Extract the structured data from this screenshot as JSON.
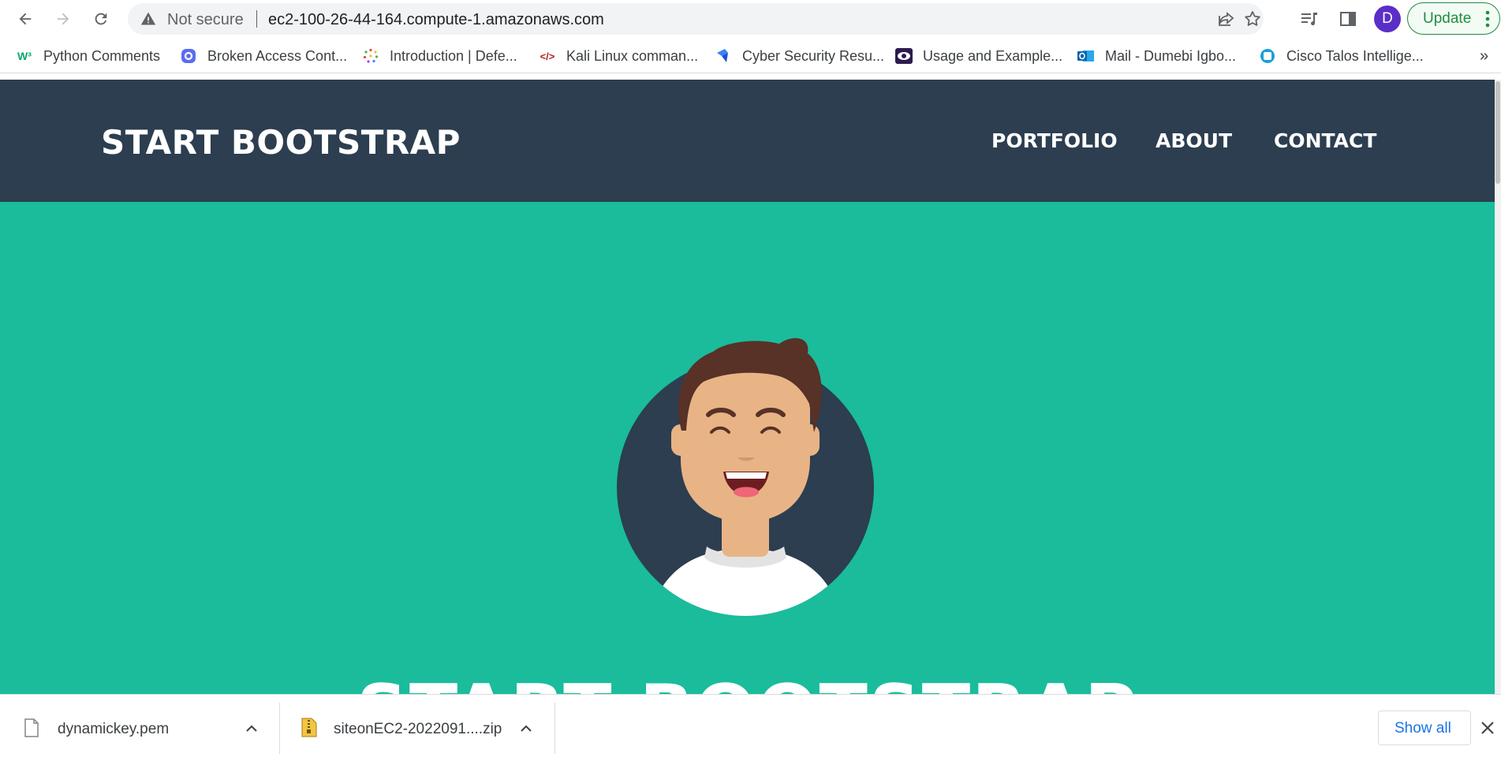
{
  "browser": {
    "security_label": "Not secure",
    "url": "ec2-100-26-44-164.compute-1.amazonaws.com",
    "profile_initial": "D",
    "update_label": "Update"
  },
  "bookmarks": [
    {
      "label": "Python Comments",
      "icon": "w3schools-icon"
    },
    {
      "label": "Broken Access Cont...",
      "icon": "bookmark-a-icon"
    },
    {
      "label": "Introduction | Defe...",
      "icon": "dots-circle-icon"
    },
    {
      "label": "Kali Linux comman...",
      "icon": "code-icon"
    },
    {
      "label": "Cyber Security Resu...",
      "icon": "blue-shape-icon"
    },
    {
      "label": "Usage and Example...",
      "icon": "eye-icon"
    },
    {
      "label": "Mail - Dumebi Igbo...",
      "icon": "outlook-icon"
    },
    {
      "label": "Cisco Talos Intellige...",
      "icon": "talos-icon"
    }
  ],
  "site": {
    "brand": "START BOOTSTRAP",
    "nav": [
      "PORTFOLIO",
      "ABOUT",
      "CONTACT"
    ],
    "masthead_title": "START BOOTSTRAP",
    "colors": {
      "nav_bg": "#2c3e50",
      "masthead_bg": "#1abc9c"
    }
  },
  "downloads": {
    "items": [
      "dynamickey.pem",
      "siteonEC2-2022091....zip"
    ],
    "show_all_label": "Show all"
  }
}
